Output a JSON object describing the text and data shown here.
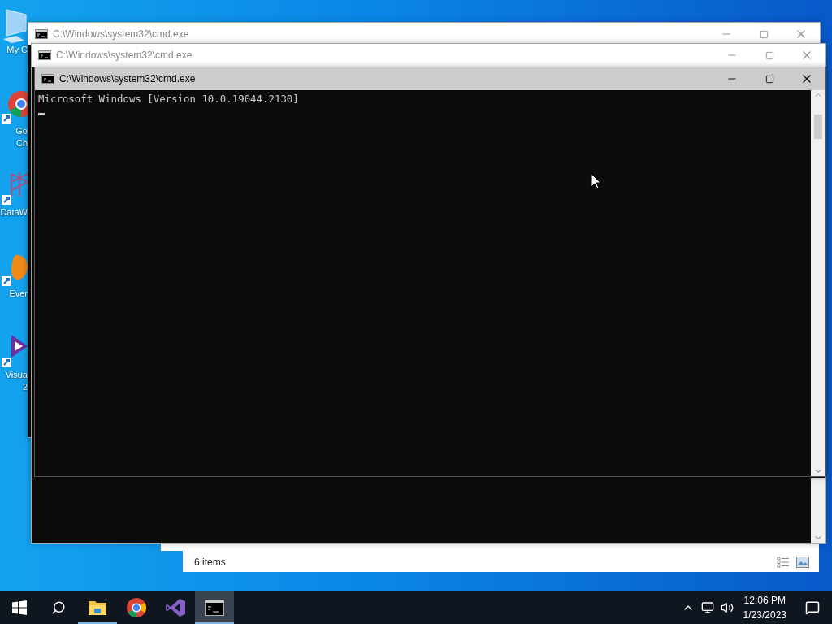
{
  "desktop_icons": [
    {
      "kind": "computer",
      "lines": [
        "My C"
      ]
    },
    {
      "kind": "chrome",
      "lines": [
        "Go",
        "Ch"
      ]
    },
    {
      "kind": "dataw",
      "lines": [
        "DataW"
      ]
    },
    {
      "kind": "evernote",
      "lines": [
        "Ever"
      ]
    },
    {
      "kind": "vs",
      "lines": [
        "Visua",
        "2"
      ]
    }
  ],
  "windows": [
    {
      "title": "C:\\Windows\\system32\\cmd.exe",
      "active": false
    },
    {
      "title": "C:\\Windows\\system32\\cmd.exe",
      "active": false
    },
    {
      "title": "C:\\Windows\\system32\\cmd.exe",
      "active": true,
      "console_lines": [
        "Microsoft Windows [Version 10.0.19044.2130]"
      ]
    }
  ],
  "explorer": {
    "status": "6 items"
  },
  "taskbar": {
    "apps": [
      {
        "kind": "explorer",
        "running": true,
        "selected": false
      },
      {
        "kind": "chrome",
        "running": false,
        "selected": false
      },
      {
        "kind": "vs",
        "running": false,
        "selected": false
      },
      {
        "kind": "cmd",
        "running": true,
        "selected": true
      }
    ],
    "clock": {
      "time": "12:06 PM",
      "date": "1/23/2023"
    }
  }
}
